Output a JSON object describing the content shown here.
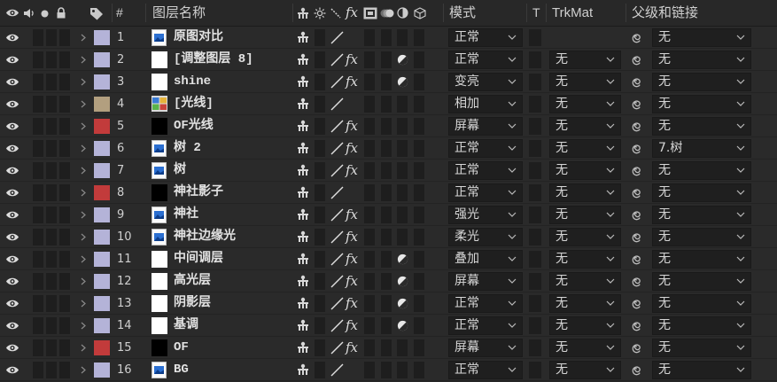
{
  "fx_label": "fx",
  "header": {
    "number_label": "#",
    "name_label": "图层名称",
    "mode_label": "模式",
    "t_label": "T",
    "trkmat_label": "TrkMat",
    "parent_label": "父级和链接",
    "icons": [
      "eye-icon",
      "speaker-icon",
      "solo-dot-icon",
      "lock-icon",
      "tag-icon",
      "shy-icon",
      "collapse-icon",
      "quality-icon",
      "frame-blending-icon",
      "motion-blur-icon",
      "adjustment-layer-icon",
      "3d-cube-icon"
    ]
  },
  "colors": {
    "background": "#262626",
    "row": "#2a2a2a",
    "text": "#d4d4d4",
    "label_lavender": "#b4b3d8",
    "label_sandstone": "#b29f7f",
    "label_red": "#c23b3b"
  },
  "layers": [
    {
      "number": "1",
      "label_color": "#b4b3d8",
      "source_icon": "image-footage-icon",
      "name": "原图对比",
      "fx": false,
      "adjustment": false,
      "mode": "正常",
      "trkmat": null,
      "parent": "无"
    },
    {
      "number": "2",
      "label_color": "#b4b3d8",
      "source_icon": "white-solid-icon",
      "name": "[调整图层 8]",
      "fx": true,
      "adjustment": true,
      "mode": "正常",
      "trkmat": "无",
      "parent": "无"
    },
    {
      "number": "3",
      "label_color": "#b4b3d8",
      "source_icon": "white-solid-icon",
      "name": "shine",
      "fx": true,
      "adjustment": true,
      "mode": "变亮",
      "trkmat": "无",
      "parent": "无"
    },
    {
      "number": "4",
      "label_color": "#b29f7f",
      "source_icon": "color-thumbnail-icon",
      "name": "[光线]",
      "fx": false,
      "adjustment": false,
      "mode": "相加",
      "trkmat": "无",
      "parent": "无"
    },
    {
      "number": "5",
      "label_color": "#c23b3b",
      "source_icon": "black-solid-icon",
      "name": "OF光线",
      "fx": true,
      "adjustment": false,
      "mode": "屏幕",
      "trkmat": "无",
      "parent": "无"
    },
    {
      "number": "6",
      "label_color": "#b4b3d8",
      "source_icon": "image-footage-icon",
      "name": "树 2",
      "fx": true,
      "adjustment": false,
      "mode": "正常",
      "trkmat": "无",
      "parent": "7.树"
    },
    {
      "number": "7",
      "label_color": "#b4b3d8",
      "source_icon": "image-footage-icon",
      "name": "树",
      "fx": true,
      "adjustment": false,
      "mode": "正常",
      "trkmat": "无",
      "parent": "无"
    },
    {
      "number": "8",
      "label_color": "#c23b3b",
      "source_icon": "black-solid-icon",
      "name": "神社影子",
      "fx": false,
      "adjustment": false,
      "mode": "正常",
      "trkmat": "无",
      "parent": "无"
    },
    {
      "number": "9",
      "label_color": "#b4b3d8",
      "source_icon": "image-footage-icon",
      "name": "神社",
      "fx": true,
      "adjustment": false,
      "mode": "强光",
      "trkmat": "无",
      "parent": "无"
    },
    {
      "number": "10",
      "label_color": "#b4b3d8",
      "source_icon": "image-footage-icon",
      "name": "神社边缘光",
      "fx": true,
      "adjustment": false,
      "mode": "柔光",
      "trkmat": "无",
      "parent": "无"
    },
    {
      "number": "11",
      "label_color": "#b4b3d8",
      "source_icon": "white-solid-icon",
      "name": "中间调层",
      "fx": true,
      "adjustment": true,
      "mode": "叠加",
      "trkmat": "无",
      "parent": "无"
    },
    {
      "number": "12",
      "label_color": "#b4b3d8",
      "source_icon": "white-solid-icon",
      "name": "高光层",
      "fx": true,
      "adjustment": true,
      "mode": "屏幕",
      "trkmat": "无",
      "parent": "无"
    },
    {
      "number": "13",
      "label_color": "#b4b3d8",
      "source_icon": "white-solid-icon",
      "name": "阴影层",
      "fx": true,
      "adjustment": true,
      "mode": "正常",
      "trkmat": "无",
      "parent": "无"
    },
    {
      "number": "14",
      "label_color": "#b4b3d8",
      "source_icon": "white-solid-icon",
      "name": "基调",
      "fx": true,
      "adjustment": true,
      "mode": "正常",
      "trkmat": "无",
      "parent": "无"
    },
    {
      "number": "15",
      "label_color": "#c23b3b",
      "source_icon": "black-solid-icon",
      "name": "OF",
      "fx": true,
      "adjustment": false,
      "mode": "屏幕",
      "trkmat": "无",
      "parent": "无"
    },
    {
      "number": "16",
      "label_color": "#b4b3d8",
      "source_icon": "image-footage-icon",
      "name": "BG",
      "fx": false,
      "adjustment": false,
      "mode": "正常",
      "trkmat": "无",
      "parent": "无"
    }
  ]
}
